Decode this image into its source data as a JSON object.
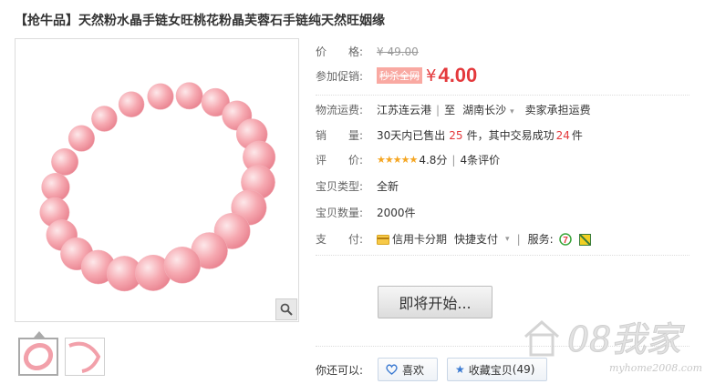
{
  "product": {
    "title": "【抢牛品】天然粉水晶手链女旺桃花粉晶芙蓉石手链纯天然旺姻缘"
  },
  "price": {
    "label_a": "价",
    "label_b": "格:",
    "original": "¥ 49.00"
  },
  "promo": {
    "label": "参加促销:",
    "tag": "秒杀全网",
    "currency": "¥",
    "price": "4.00"
  },
  "shipping": {
    "label": "物流运费:",
    "from": "江苏连云港",
    "to_word": "至",
    "to": "湖南长沙",
    "fee": "卖家承担运费"
  },
  "sales": {
    "label_a": "销",
    "label_b": "量:",
    "prefix": "30天内已售出",
    "sold": "25",
    "middle": "件，其中交易成功",
    "success": "24",
    "suffix": "件"
  },
  "rating": {
    "label_a": "评",
    "label_b": "价:",
    "stars": 5,
    "score": "4.8分",
    "reviews": "4条评价"
  },
  "condition": {
    "label": "宝贝类型:",
    "value": "全新"
  },
  "quantity": {
    "label": "宝贝数量:",
    "value": "2000件"
  },
  "payment": {
    "label_a": "支",
    "label_b": "付:",
    "credit": "信用卡分期",
    "quick": "快捷支付",
    "service_label": "服务:"
  },
  "actions": {
    "buy": "即将开始...",
    "also_label": "你还可以:",
    "like": "喜欢",
    "favorite": "收藏宝贝",
    "favorite_count": "(49)"
  },
  "watermark": {
    "brand": "08我家",
    "url": "myhome2008.com"
  },
  "colors": {
    "accent_red": "#e4393c",
    "promo_tag": "#f9a9a2",
    "star": "#f5a623"
  }
}
